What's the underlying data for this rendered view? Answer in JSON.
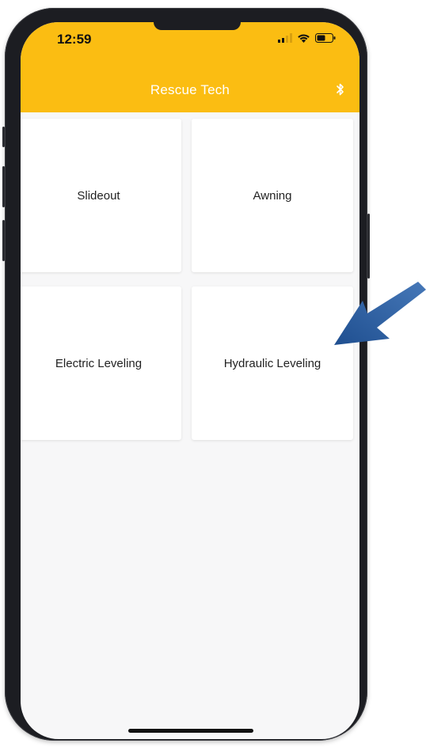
{
  "status_bar": {
    "time": "12:59",
    "signal_icon": "cellular-signal-icon",
    "wifi_icon": "wifi-icon",
    "battery_icon": "battery-icon"
  },
  "header": {
    "title": "Rescue Tech",
    "bluetooth_icon": "bluetooth-icon",
    "color": "#fbbd12"
  },
  "tiles": [
    {
      "label": "Slideout"
    },
    {
      "label": "Awning"
    },
    {
      "label": "Electric Leveling"
    },
    {
      "label": "Hydraulic Leveling"
    }
  ],
  "annotation": {
    "arrow_icon": "pointer-arrow-icon",
    "arrow_color": "#2f5fa0"
  }
}
